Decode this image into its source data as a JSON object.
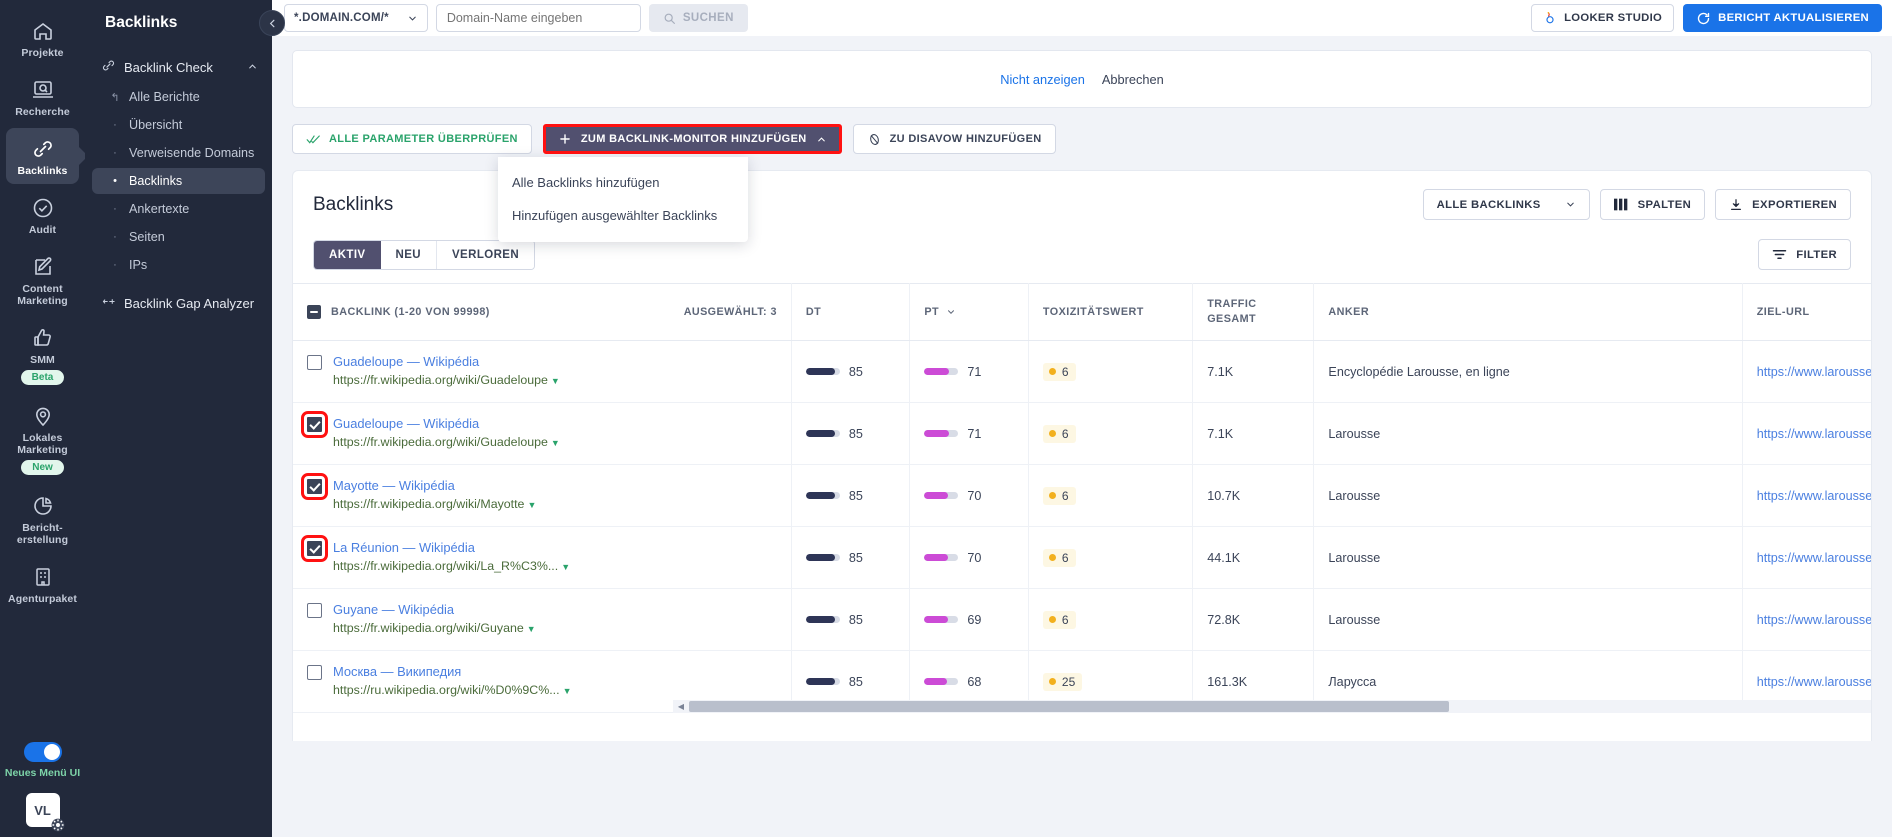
{
  "rail": {
    "items": [
      {
        "label": "Projekte",
        "icon": "home-icon",
        "active": false
      },
      {
        "label": "Recherche",
        "icon": "research-icon",
        "active": false
      },
      {
        "label": "Backlinks",
        "icon": "link-icon",
        "active": true
      },
      {
        "label": "Audit",
        "icon": "check-circle-icon",
        "active": false
      },
      {
        "label": "Content\nMarketing",
        "icon": "edit-square-icon",
        "active": false
      },
      {
        "label": "SMM",
        "icon": "thumbs-up-icon",
        "active": false,
        "badge": "Beta"
      },
      {
        "label": "Lokales\nMarketing",
        "icon": "pin-icon",
        "active": false,
        "badge": "New"
      },
      {
        "label": "Bericht-\nerstellung",
        "icon": "pie-chart-icon",
        "active": false
      },
      {
        "label": "Agenturpaket",
        "icon": "building-icon",
        "active": false
      }
    ],
    "toggle_label": "Neues Menü\nUI",
    "avatar_initials": "VL"
  },
  "subnav": {
    "title": "Backlinks",
    "group_label": "Backlink Check",
    "items": [
      {
        "label": "Alle Berichte",
        "marker": "↰",
        "active": false
      },
      {
        "label": "Übersicht",
        "marker": "·",
        "active": false
      },
      {
        "label": "Verweisende Domains",
        "marker": "·",
        "active": false
      },
      {
        "label": "Backlinks",
        "marker": "•",
        "active": true
      },
      {
        "label": "Ankertexte",
        "marker": "·",
        "active": false
      },
      {
        "label": "Seiten",
        "marker": "·",
        "active": false
      },
      {
        "label": "IPs",
        "marker": "·",
        "active": false
      }
    ],
    "gap_analyzer_label": "Backlink Gap Analyzer"
  },
  "topbar": {
    "domain_scope": "*.DOMAIN.COM/*",
    "domain_placeholder": "Domain-Name eingeben",
    "domain_value": "",
    "search_label": "SUCHEN",
    "looker_label": "LOOKER STUDIO",
    "update_label": "BERICHT AKTUALISIEREN"
  },
  "notice": {
    "dismiss_label": "Nicht anzeigen",
    "cancel_label": "Abbrechen"
  },
  "actions": {
    "check_all_params": "ALLE PARAMETER ÜBERPRÜFEN",
    "add_to_monitor": "ZUM BACKLINK-MONITOR HINZUFÜGEN",
    "add_to_disavow": "ZU DISAVOW HINZUFÜGEN",
    "menu": [
      "Alle Backlinks hinzufügen",
      "Hinzufügen ausgewählter Backlinks"
    ]
  },
  "card": {
    "title": "Backlinks",
    "filter_select": "ALLE BACKLINKS",
    "columns_label": "SPALTEN",
    "export_label": "EXPORTIEREN",
    "tabs": [
      {
        "label": "AKTIV",
        "active": true
      },
      {
        "label": "NEU",
        "active": false
      },
      {
        "label": "VERLOREN",
        "active": false
      }
    ],
    "filter_label": "FILTER"
  },
  "table": {
    "columns": {
      "backlink": "BACKLINK (1-20 VON 99998)",
      "selected": "AUSGEWÄHLT: 3",
      "dt": "DT",
      "pt": "PT",
      "toxicity": "TOXIZITÄTSWERT",
      "traffic": "TRAFFIC\nGESAMT",
      "anchor": "ANKER",
      "target_url": "ZIEL-URL"
    },
    "rows": [
      {
        "checked": false,
        "highlight": false,
        "title": "Guadeloupe — Wikipédia",
        "url": "https://fr.wikipedia.org/wiki/Guadeloupe",
        "dt": "85",
        "pt": "71",
        "toxicity": "6",
        "traffic": "7.1K",
        "anchor": "Encyclopédie Larousse, en ligne",
        "target_url": "https://www.larousse.fr/encyclope"
      },
      {
        "checked": true,
        "highlight": true,
        "title": "Guadeloupe — Wikipédia",
        "url": "https://fr.wikipedia.org/wiki/Guadeloupe",
        "dt": "85",
        "pt": "71",
        "toxicity": "6",
        "traffic": "7.1K",
        "anchor": "Larousse",
        "target_url": "https://www.larousse.fr/encyclope"
      },
      {
        "checked": true,
        "highlight": true,
        "title": "Mayotte — Wikipédia",
        "url": "https://fr.wikipedia.org/wiki/Mayotte",
        "dt": "85",
        "pt": "70",
        "toxicity": "6",
        "traffic": "10.7K",
        "anchor": "Larousse",
        "target_url": "https://www.larousse.fr/encyclope"
      },
      {
        "checked": true,
        "highlight": true,
        "title": "La Réunion — Wikipédia",
        "url": "https://fr.wikipedia.org/wiki/La_R%C3%...",
        "dt": "85",
        "pt": "70",
        "toxicity": "6",
        "traffic": "44.1K",
        "anchor": "Larousse",
        "target_url": "https://www.larousse.fr/encyclope"
      },
      {
        "checked": false,
        "highlight": false,
        "title": "Guyane — Wikipédia",
        "url": "https://fr.wikipedia.org/wiki/Guyane",
        "dt": "85",
        "pt": "69",
        "toxicity": "6",
        "traffic": "72.8K",
        "anchor": "Larousse",
        "target_url": "https://www.larousse.fr/encyclope"
      },
      {
        "checked": false,
        "highlight": false,
        "title": "Москва — Википедия",
        "url": "https://ru.wikipedia.org/wiki/%D0%9C%...",
        "dt": "85",
        "pt": "68",
        "toxicity": "25",
        "traffic": "161.3K",
        "anchor": "Ларусса",
        "target_url": "https://www.larousse.fr/encyclope"
      }
    ]
  },
  "colors": {
    "accent_blue": "#1a73e8",
    "dark_nav": "#22293b",
    "purple": "#51506f",
    "highlight_red": "#ff1111",
    "green": "#2aa36b",
    "magenta": "#cc4bd6",
    "amber": "#f2b01e"
  }
}
